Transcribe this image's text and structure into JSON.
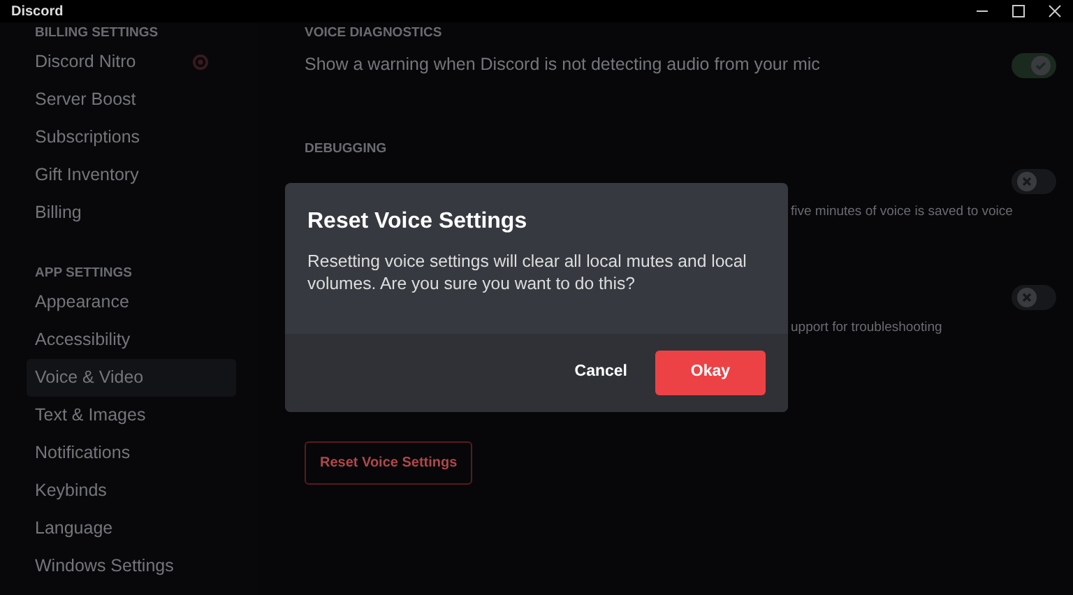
{
  "window": {
    "title": "Discord"
  },
  "sidebar": {
    "sections": [
      {
        "heading": "BILLING SETTINGS",
        "items": [
          {
            "label": "Discord Nitro",
            "selected": false,
            "kind": "nitro"
          },
          {
            "label": "Server Boost",
            "selected": false
          },
          {
            "label": "Subscriptions",
            "selected": false
          },
          {
            "label": "Gift Inventory",
            "selected": false
          },
          {
            "label": "Billing",
            "selected": false
          }
        ]
      },
      {
        "heading": "APP SETTINGS",
        "items": [
          {
            "label": "Appearance",
            "selected": false
          },
          {
            "label": "Accessibility",
            "selected": false
          },
          {
            "label": "Voice & Video",
            "selected": true
          },
          {
            "label": "Text & Images",
            "selected": false
          },
          {
            "label": "Notifications",
            "selected": false
          },
          {
            "label": "Keybinds",
            "selected": false
          },
          {
            "label": "Language",
            "selected": false
          },
          {
            "label": "Windows Settings",
            "selected": false
          }
        ]
      }
    ]
  },
  "content": {
    "diagnostics": {
      "heading": "VOICE DIAGNOSTICS",
      "text": "Show a warning when Discord is not detecting audio from your mic",
      "on": true
    },
    "debugging": {
      "heading": "DEBUGGING",
      "rows": [
        {
          "on": false,
          "note": "five minutes of voice is saved to voice"
        },
        {
          "on": false,
          "note": "upport for troubleshooting"
        }
      ]
    },
    "reset_button": "Reset Voice Settings"
  },
  "dialog": {
    "title": "Reset Voice Settings",
    "message": "Resetting voice settings will clear all local mutes and local volumes. Are you sure you want to do this?",
    "buttons": [
      {
        "label": "Cancel",
        "kind": "link"
      },
      {
        "label": "Okay",
        "kind": "danger"
      }
    ]
  }
}
